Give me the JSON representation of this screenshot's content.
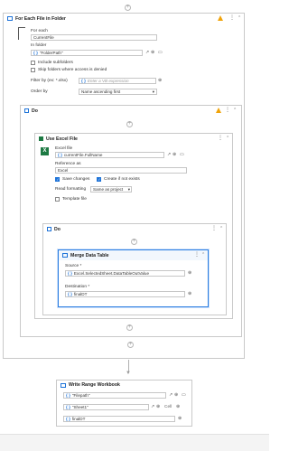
{
  "foreach": {
    "title": "For Each File in Folder",
    "for_each_label": "For each",
    "for_each_value": "CurrentFile",
    "in_folder_label": "In folder",
    "in_folder_value": "\"FolderPath\"",
    "include_subfolders": "Include subfolders",
    "skip_denied": "Skip folders where access is denied",
    "filter_label": "Filter by (ex: *.xlsx)",
    "filter_placeholder": "Enter a VB expression",
    "order_label": "Order by",
    "order_value": "Name ascending first"
  },
  "do_outer": {
    "title": "Do"
  },
  "excel": {
    "title": "Use Excel File",
    "file_label": "Excel file",
    "file_value": "currentFile.FullName",
    "ref_label": "Reference as",
    "ref_value": "Excel",
    "save_changes": "Save changes",
    "create_if_not": "Create if not exists",
    "read_format_label": "Read formatting",
    "read_format_value": "Same as project",
    "template_file": "Template file"
  },
  "do_inner": {
    "title": "Do"
  },
  "merge": {
    "title": "Merge Data Table",
    "source_label": "Source *",
    "source_value": "Excel.SelectedSheet.DataTableOutValue",
    "dest_label": "Destination *",
    "dest_value": "finalDT"
  },
  "write": {
    "title": "Write Range Workbook",
    "file_value": "\"Filepath\"",
    "sheet_value": "\"Sheet1\"",
    "cell_label": "Cell",
    "data_value": "finalDT"
  },
  "common": {
    "expr": "{ }",
    "plus": "+",
    "kebab": "⋮",
    "collapse": "⌃",
    "arrow_down": "▾"
  },
  "colors": {
    "accent": "#1e73d8",
    "warning": "#f0a30a",
    "excel": "#1d7a43"
  }
}
